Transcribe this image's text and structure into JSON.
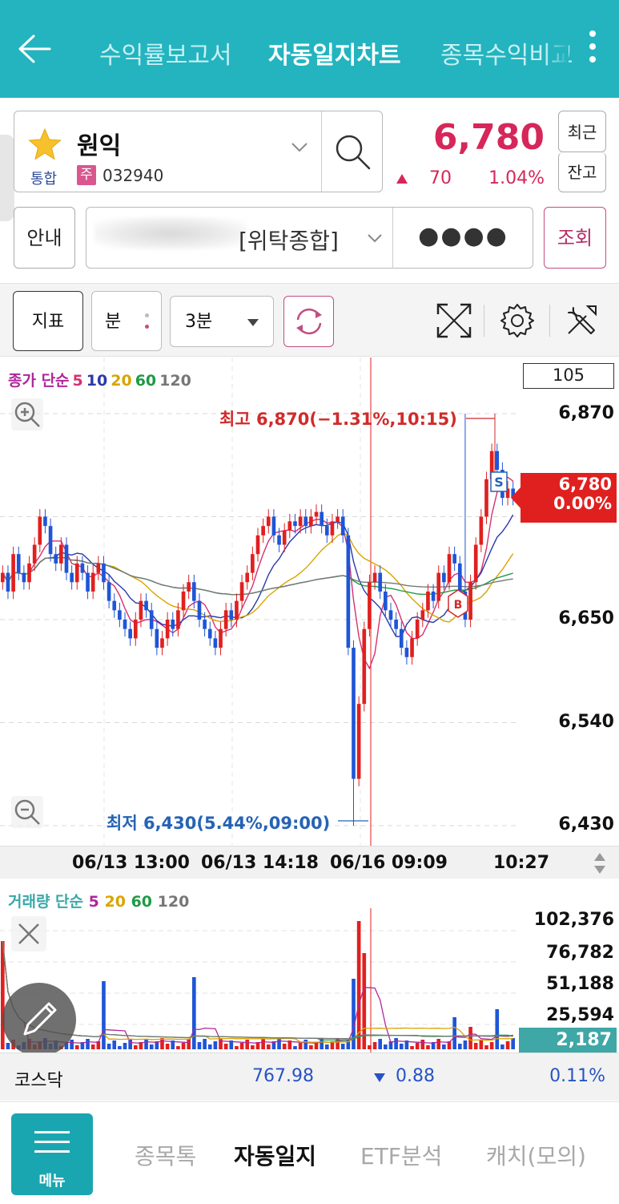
{
  "header": {
    "tabs": [
      "수익률보고서",
      "자동일지차트",
      "종목수익비교"
    ],
    "active_tab": "자동일지차트"
  },
  "stock": {
    "name": "원익",
    "market": "통합",
    "type_badge": "주",
    "code": "032940",
    "price": "6,780",
    "change": "70",
    "change_pct": "1.04%",
    "recent_label": "최근",
    "balance_label": "잔고"
  },
  "account": {
    "guide_label": "안내",
    "account_type": "[위탁종합]",
    "password_mask": "●●●●",
    "query_label": "조회"
  },
  "toolbar": {
    "indicator_label": "지표",
    "unit_label": "분",
    "period_value": "3분"
  },
  "chart_meta": {
    "ma_legend": [
      {
        "text": "종가 단순",
        "color": "#b0279a"
      },
      {
        "text": "5",
        "color": "#d6306f"
      },
      {
        "text": "10",
        "color": "#2b3aa8"
      },
      {
        "text": "20",
        "color": "#d9a400"
      },
      {
        "text": "60",
        "color": "#1f9a46"
      },
      {
        "text": "120",
        "color": "#777777"
      }
    ],
    "visible_count": "105",
    "y_ticks": [
      "6,870",
      "6,650",
      "6,540",
      "6,430"
    ],
    "current_tag_price": "6,780",
    "current_tag_pct": "0.00%",
    "high_label": "최고 6,870(−1.31%,10:15)",
    "low_label": "최저 6,430(5.44%,09:00)",
    "time_labels": [
      "06/13 13:00",
      "06/13 14:18",
      "06/16 09:09",
      "10:27"
    ],
    "volume_legend": [
      {
        "text": "거래량 단순",
        "color": "#3aa8a8"
      },
      {
        "text": "5",
        "color": "#b0279a"
      },
      {
        "text": "20",
        "color": "#d9a400"
      },
      {
        "text": "60",
        "color": "#1f9a46"
      },
      {
        "text": "120",
        "color": "#777777"
      }
    ],
    "volume_ticks": [
      "102,376",
      "76,782",
      "51,188",
      "25,594"
    ],
    "current_volume": "2,187",
    "colors": {
      "up": "#e0201f",
      "down": "#1f55d6",
      "accent": "#23b4bf"
    }
  },
  "chart_data": {
    "type": "candlestick",
    "title": "",
    "y_range": [
      6430,
      6870
    ],
    "high": {
      "value": 6870,
      "time": "10:15"
    },
    "low": {
      "value": 6430,
      "time": "09:00"
    },
    "last": 6780,
    "candles_close": [
      6700,
      6680,
      6720,
      6700,
      6690,
      6710,
      6730,
      6760,
      6750,
      6720,
      6710,
      6730,
      6700,
      6690,
      6710,
      6700,
      6680,
      6700,
      6710,
      6690,
      6670,
      6660,
      6650,
      6640,
      6630,
      6650,
      6670,
      6660,
      6640,
      6620,
      6630,
      6650,
      6640,
      6660,
      6680,
      6690,
      6670,
      6650,
      6640,
      6630,
      6620,
      6640,
      6660,
      6650,
      6670,
      6690,
      6700,
      6720,
      6740,
      6750,
      6760,
      6740,
      6730,
      6745,
      6755,
      6750,
      6760,
      6750,
      6760,
      6765,
      6750,
      6740,
      6755,
      6760,
      6740,
      6620,
      6480,
      6560,
      6640,
      6690,
      6700,
      6680,
      6660,
      6650,
      6640,
      6620,
      6610,
      6630,
      6650,
      6660,
      6680,
      6670,
      6700,
      6690,
      6720,
      6710,
      6680,
      6650,
      6690,
      6730,
      6760,
      6800,
      6830,
      6810,
      6780,
      6790,
      6780
    ]
  },
  "index": {
    "name": "코스닥",
    "value": "767.98",
    "change": "0.88",
    "pct": "0.11%"
  },
  "bottom_nav": {
    "menu_label": "메뉴",
    "items": [
      "종목톡",
      "자동일지",
      "ETF분석",
      "캐치(모의)"
    ],
    "active": "자동일지"
  }
}
